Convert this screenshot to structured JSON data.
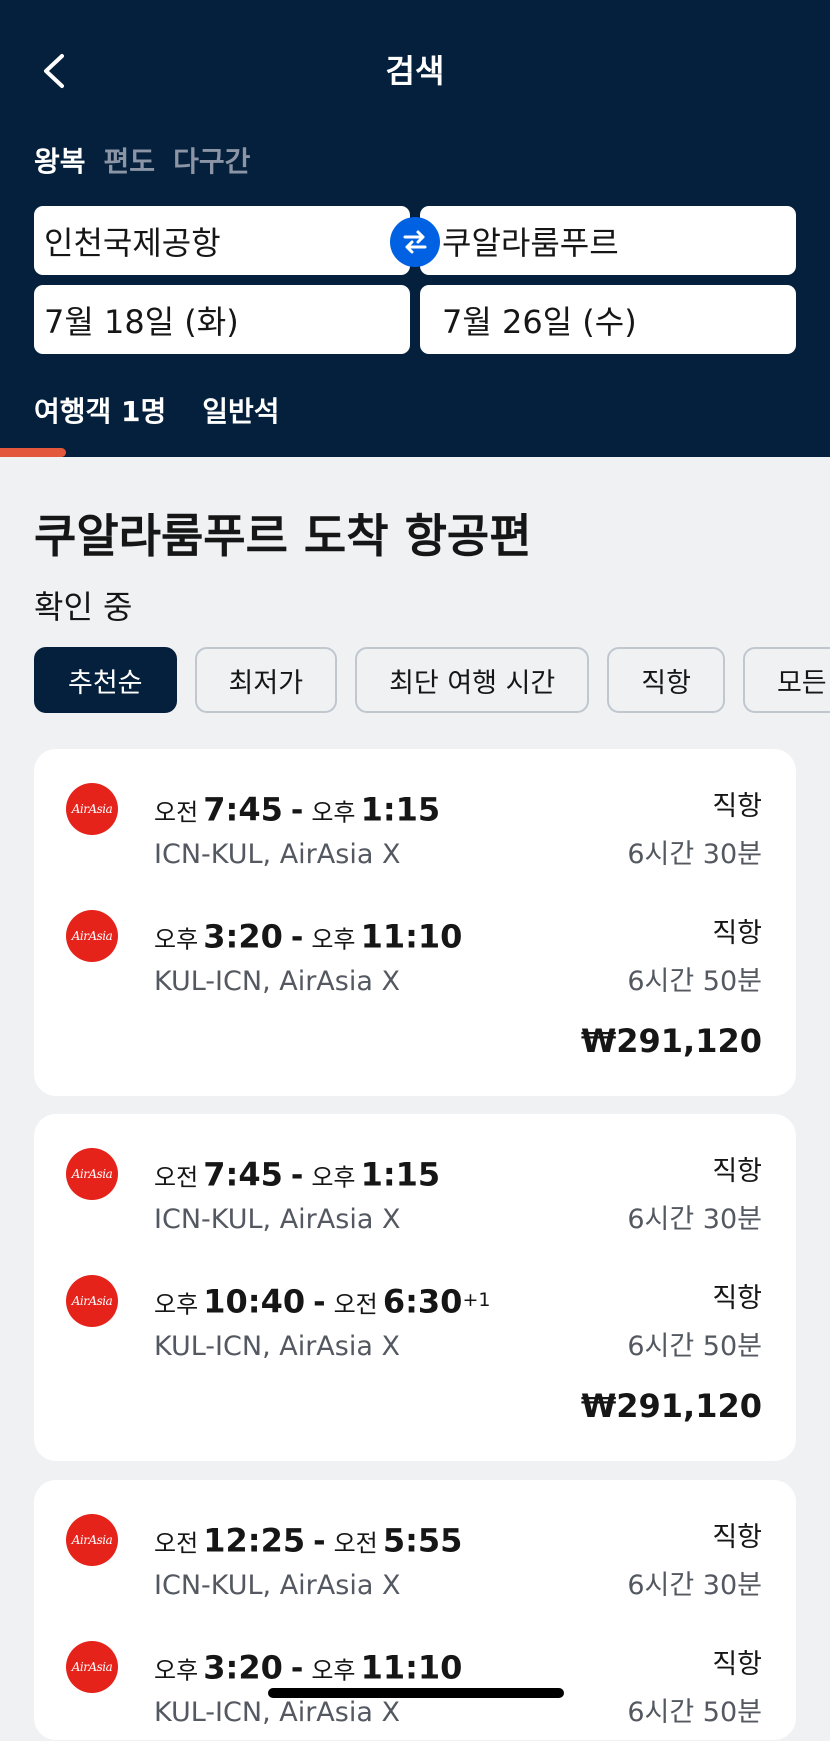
{
  "header": {
    "title": "검색",
    "trip_tabs": [
      "왕복",
      "편도",
      "다구간"
    ],
    "origin": "인천국제공항",
    "destination": "쿠알라룸푸르",
    "depart_date": "7월 18일 (화)",
    "return_date": "7월 26일 (수)",
    "travelers": "여행객 1명",
    "cabin_class": "일반석",
    "progress_fraction": 0.08,
    "colors": {
      "header_bg": "#05203c",
      "accent": "#0062e3",
      "progress": "#e3573c"
    }
  },
  "results": {
    "title": "쿠알라룸푸르 도착 항공편",
    "status": "확인 중",
    "filters": [
      "추천순",
      "최저가",
      "최단 여행 시간",
      "직항",
      "모든"
    ]
  },
  "cards": [
    {
      "legs": [
        {
          "dep_ampm": "오전",
          "dep_time": "7:45",
          "arr_ampm": "오후",
          "arr_time": "1:15",
          "arr_plus": "",
          "route": "ICN-KUL, AirAsia X",
          "stops": "직항",
          "duration": "6시간 30분",
          "logo": "AirAsia"
        },
        {
          "dep_ampm": "오후",
          "dep_time": "3:20",
          "arr_ampm": "오후",
          "arr_time": "11:10",
          "arr_plus": "",
          "route": "KUL-ICN, AirAsia X",
          "stops": "직항",
          "duration": "6시간 50분",
          "logo": "AirAsia"
        }
      ],
      "price": "₩291,120"
    },
    {
      "legs": [
        {
          "dep_ampm": "오전",
          "dep_time": "7:45",
          "arr_ampm": "오후",
          "arr_time": "1:15",
          "arr_plus": "",
          "route": "ICN-KUL, AirAsia X",
          "stops": "직항",
          "duration": "6시간 30분",
          "logo": "AirAsia"
        },
        {
          "dep_ampm": "오후",
          "dep_time": "10:40",
          "arr_ampm": "오전",
          "arr_time": "6:30",
          "arr_plus": "+1",
          "route": "KUL-ICN, AirAsia X",
          "stops": "직항",
          "duration": "6시간 50분",
          "logo": "AirAsia"
        }
      ],
      "price": "₩291,120"
    },
    {
      "legs": [
        {
          "dep_ampm": "오전",
          "dep_time": "12:25",
          "arr_ampm": "오전",
          "arr_time": "5:55",
          "arr_plus": "",
          "route": "ICN-KUL, AirAsia X",
          "stops": "직항",
          "duration": "6시간 30분",
          "logo": "AirAsia"
        },
        {
          "dep_ampm": "오후",
          "dep_time": "3:20",
          "arr_ampm": "오후",
          "arr_time": "11:10",
          "arr_plus": "",
          "route": "KUL-ICN, AirAsia X",
          "stops": "직항",
          "duration": "6시간 50분",
          "logo": "AirAsia"
        }
      ],
      "price": ""
    }
  ]
}
